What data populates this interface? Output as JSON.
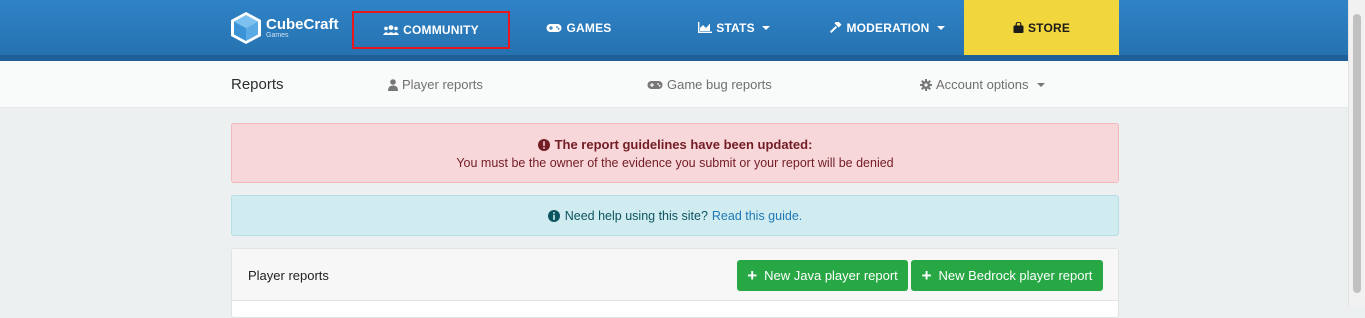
{
  "brand": {
    "name": "CubeCraft",
    "sub": "Games"
  },
  "nav": {
    "community": "COMMUNITY",
    "games": "GAMES",
    "stats": "STATS",
    "moderation": "MODERATION",
    "store": "STORE"
  },
  "subnav": {
    "title": "Reports",
    "player_reports": "Player reports",
    "game_bug_reports": "Game bug reports",
    "account_options": "Account options"
  },
  "alerts": {
    "danger_title": "The report guidelines have been updated:",
    "danger_body": "You must be the owner of the evidence you submit or your report will be denied",
    "info_text": "Need help using this site?",
    "info_link": "Read this guide."
  },
  "card": {
    "title": "Player reports",
    "java_button": "New Java player report",
    "bedrock_button": "New Bedrock player report"
  },
  "colors": {
    "nav_blue": "#2a78b9",
    "store_yellow": "#f2d63d",
    "danger_bg": "#f8d7da",
    "info_bg": "#d1ecf1",
    "button_green": "#28a745",
    "highlight_red": "#e8171d"
  }
}
